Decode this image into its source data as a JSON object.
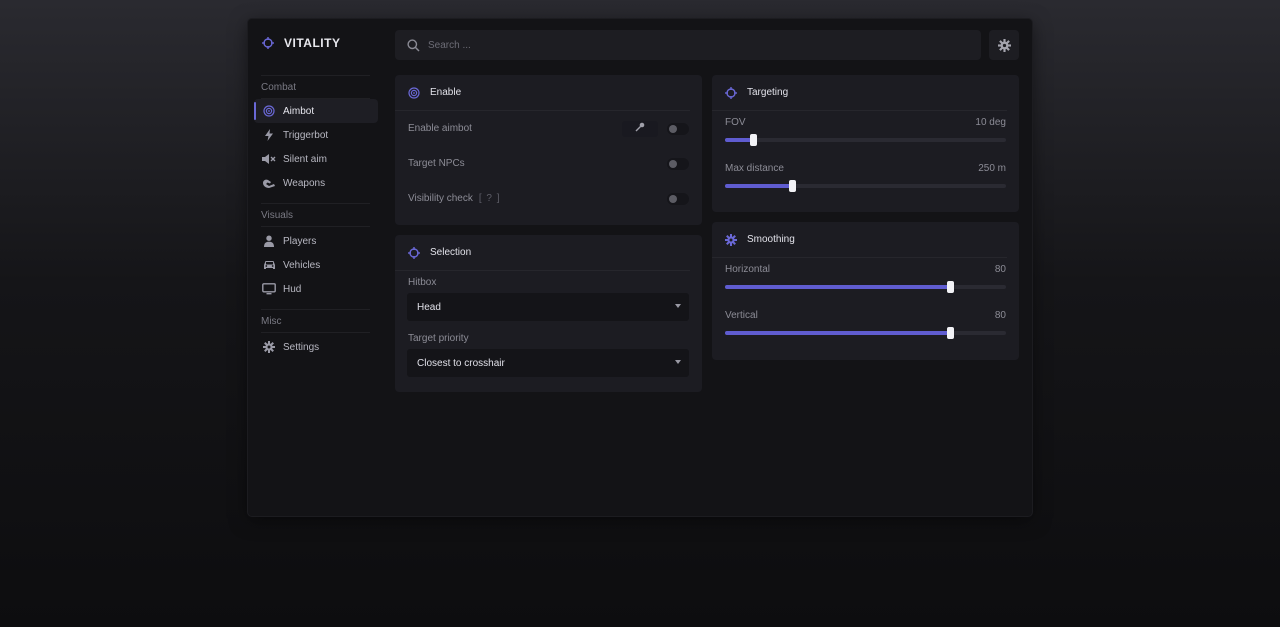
{
  "brand": {
    "title": "VITALITY"
  },
  "search": {
    "placeholder": "Search ..."
  },
  "sidebar": {
    "groups": [
      {
        "label": "Combat",
        "items": [
          {
            "label": "Aimbot",
            "icon": "target-icon",
            "active": true
          },
          {
            "label": "Triggerbot",
            "icon": "bolt-icon"
          },
          {
            "label": "Silent aim",
            "icon": "mute-icon"
          },
          {
            "label": "Weapons",
            "icon": "hands-icon"
          }
        ]
      },
      {
        "label": "Visuals",
        "items": [
          {
            "label": "Players",
            "icon": "person-icon"
          },
          {
            "label": "Vehicles",
            "icon": "car-icon"
          },
          {
            "label": "Hud",
            "icon": "monitor-icon"
          }
        ]
      },
      {
        "label": "Misc",
        "items": [
          {
            "label": "Settings",
            "icon": "gear-icon"
          }
        ]
      }
    ]
  },
  "enable_card": {
    "title": "Enable",
    "rows": [
      {
        "label": "Enable aimbot",
        "on": false,
        "has_key": true
      },
      {
        "label": "Target NPCs",
        "on": false
      },
      {
        "label": "Visibility check",
        "hint": "[ ? ]",
        "on": false
      }
    ]
  },
  "selection_card": {
    "title": "Selection",
    "hitbox_label": "Hitbox",
    "hitbox_value": "Head",
    "priority_label": "Target priority",
    "priority_value": "Closest to crosshair"
  },
  "targeting_card": {
    "title": "Targeting",
    "sliders": [
      {
        "label": "FOV",
        "value_text": "10 deg",
        "fraction": 0.1
      },
      {
        "label": "Max distance",
        "value_text": "250 m",
        "fraction": 0.24
      }
    ]
  },
  "smoothing_card": {
    "title": "Smoothing",
    "sliders": [
      {
        "label": "Horizontal",
        "value_text": "80",
        "fraction": 0.8
      },
      {
        "label": "Vertical",
        "value_text": "80",
        "fraction": 0.8
      }
    ]
  },
  "colors": {
    "accent": "#5f5cd0",
    "background": "#131316",
    "card": "#1c1c22"
  }
}
